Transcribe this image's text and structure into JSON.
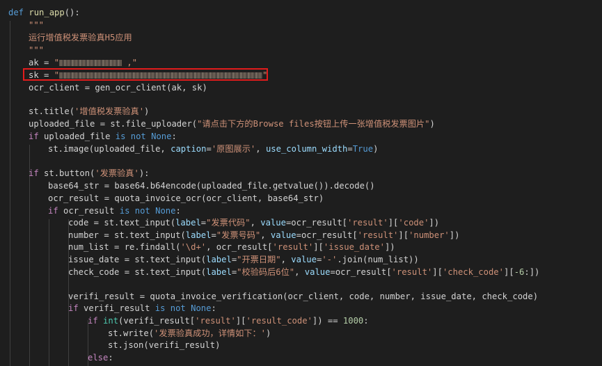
{
  "code": {
    "l1_def": "def",
    "l1_name": " run_app",
    "l1_rest": "():",
    "l2": "\"\"\"",
    "l3": "运行增值税发票验真H5应用",
    "l4": "\"\"\"",
    "l5_var": "ak = ",
    "l5_q1": "\"",
    "l5_tail": " ,",
    "l5_q2": "\"",
    "l6_var": "sk = ",
    "l6_q1": "\"",
    "l6_q2": "\"",
    "l7": "ocr_client = gen_ocr_client(ak, sk)",
    "l9_a": "st.title(",
    "l9_s": "'增值税发票验真'",
    "l9_b": ")",
    "l10_a": "uploaded_file = st.file_uploader(",
    "l10_s": "\"请点击下方的Browse files按钮上传一张增值税发票图片\"",
    "l10_b": ")",
    "l11_if": "if",
    "l11_a": " uploaded_file ",
    "l11_is": "is not None",
    "l11_b": ":",
    "l12_a": "st.image(uploaded_file, ",
    "l12_p1": "caption",
    "l12_eq1": "=",
    "l12_s": "'原图展示'",
    "l12_c": ", ",
    "l12_p2": "use_column_width",
    "l12_eq2": "=",
    "l12_true": "True",
    "l12_b": ")",
    "l14_if": "if",
    "l14_a": " st.button(",
    "l14_s": "'发票验真'",
    "l14_b": "):",
    "l15": "base64_str = base64.b64encode(uploaded_file.getvalue()).decode()",
    "l16": "ocr_result = quota_invoice_ocr(ocr_client, base64_str)",
    "l17_if": "if",
    "l17_a": " ocr_result ",
    "l17_is": "is not None",
    "l17_b": ":",
    "l18_a": "code = st.text_input(",
    "l18_p1": "label",
    "l18_s1": "\"发票代码\"",
    "l18_p2": "value",
    "l18_c": "ocr_result[",
    "l18_k1": "'result'",
    "l18_m": "][",
    "l18_k2": "'code'",
    "l18_e": "])",
    "l19_a": "number = st.text_input(",
    "l19_p1": "label",
    "l19_s1": "\"发票号码\"",
    "l19_p2": "value",
    "l19_c": "ocr_result[",
    "l19_k1": "'result'",
    "l19_m": "][",
    "l19_k2": "'number'",
    "l19_e": "])",
    "l20_a": "num_list = re.findall(",
    "l20_s": "'\\d+'",
    "l20_b": ", ocr_result[",
    "l20_k1": "'result'",
    "l20_m": "][",
    "l20_k2": "'issue_date'",
    "l20_e": "])",
    "l21_a": "issue_date = st.text_input(",
    "l21_p1": "label",
    "l21_s1": "\"开票日期\"",
    "l21_p2": "value",
    "l21_s2": "'-'",
    "l21_e": ".join(num_list))",
    "l22_a": "check_code = st.text_input(",
    "l22_p1": "label",
    "l22_s1": "\"校验码后6位\"",
    "l22_p2": "value",
    "l22_c": "ocr_result[",
    "l22_k1": "'result'",
    "l22_m": "][",
    "l22_k2": "'check_code'",
    "l22_m2": "][",
    "l22_n": "-6",
    "l22_e": ":])",
    "l24": "verifi_result = quota_invoice_verification(ocr_client, code, number, issue_date, check_code)",
    "l25_if": "if",
    "l25_a": " verifi_result ",
    "l25_is": "is not None",
    "l25_b": ":",
    "l26_if": "if",
    "l26_int": " int",
    "l26_a": "(verifi_result[",
    "l26_k1": "'result'",
    "l26_m": "][",
    "l26_k2": "'result_code'",
    "l26_b": "]) == ",
    "l26_n": "1000",
    "l26_c": ":",
    "l27_a": "st.write(",
    "l27_s": "'发票验真成功，详情如下：'",
    "l27_b": ")",
    "l28": "st.json(verifi_result)",
    "l29_else": "else",
    "l29_c": ":",
    "comma": ", ",
    "eq": "="
  },
  "annotation": {
    "highlight_color": "#e21c1c"
  }
}
